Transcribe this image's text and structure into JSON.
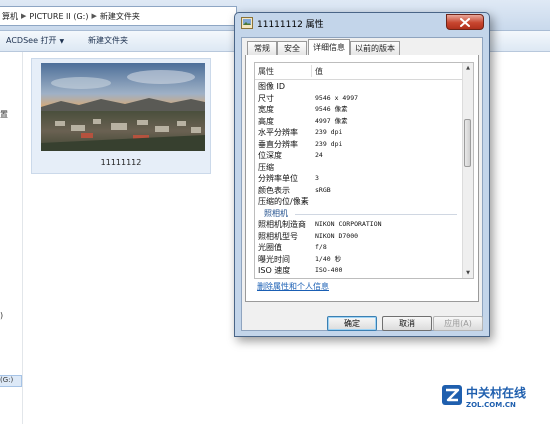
{
  "explorer": {
    "breadcrumb": [
      "算机",
      "PICTURE II (G:)",
      "新建文件夹"
    ],
    "toolbar": {
      "acdsee_label": "ACDSee 打开",
      "new_folder_label": "新建文件夹"
    },
    "nav_fragments": [
      "置",
      ")",
      "(G:)"
    ],
    "file": {
      "name": "11111112"
    }
  },
  "dialog": {
    "title": "11111112 属性",
    "tabs": [
      "常规",
      "安全",
      "详细信息",
      "以前的版本"
    ],
    "active_tab": "详细信息",
    "columns": {
      "property": "属性",
      "value": "值"
    },
    "rows": [
      {
        "name": "图像 ID",
        "value": ""
      },
      {
        "name": "尺寸",
        "value": "9546 x 4997"
      },
      {
        "name": "宽度",
        "value": "9546 像素"
      },
      {
        "name": "高度",
        "value": "4997 像素"
      },
      {
        "name": "水平分辨率",
        "value": "239 dpi"
      },
      {
        "name": "垂直分辨率",
        "value": "239 dpi"
      },
      {
        "name": "位深度",
        "value": "24"
      },
      {
        "name": "压缩",
        "value": ""
      },
      {
        "name": "分辨率单位",
        "value": "3"
      },
      {
        "name": "颜色表示",
        "value": "sRGB"
      },
      {
        "name": "压缩的位/像素",
        "value": ""
      },
      {
        "group": "照相机"
      },
      {
        "name": "照相机制造商",
        "value": "NIKON CORPORATION"
      },
      {
        "name": "照相机型号",
        "value": "NIKON D7000"
      },
      {
        "name": "光圈值",
        "value": "f/8"
      },
      {
        "name": "曝光时间",
        "value": "1/40 秒"
      },
      {
        "name": "ISO 速度",
        "value": "ISO-400"
      }
    ],
    "remove_link": "删除属性和个人信息",
    "buttons": {
      "ok": "确定",
      "cancel": "取消",
      "apply": "应用(A)"
    },
    "apply_enabled": false
  },
  "watermark": {
    "cn": "中关村在线",
    "en": "ZOL.COM.CN"
  },
  "colors": {
    "accent": "#1f5fae",
    "titlebar": "#c3d5ea",
    "close": "#c8462f",
    "link": "#1a5fb4"
  }
}
